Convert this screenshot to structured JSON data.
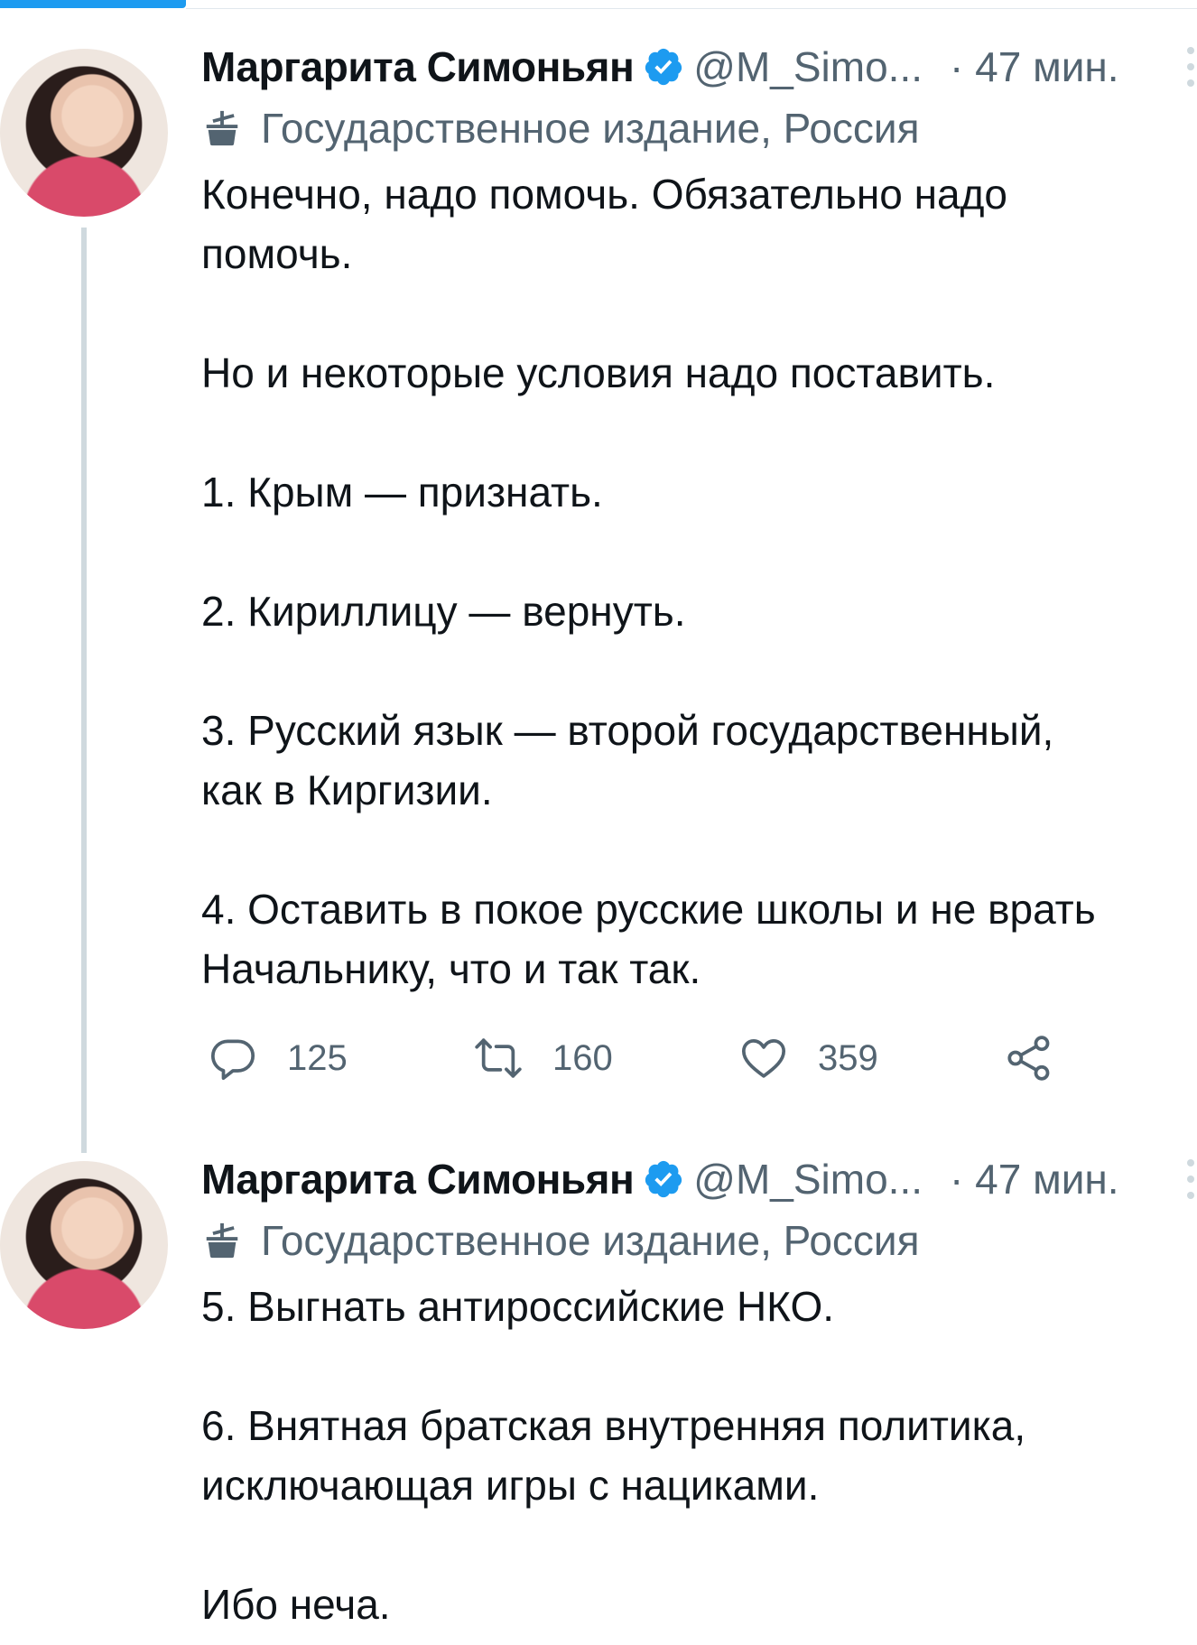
{
  "colors": {
    "accent": "#1d9bf0",
    "text_primary": "#0f1419",
    "text_secondary": "#536471",
    "thread_line": "#cfd9de"
  },
  "tweets": [
    {
      "author_name": "Маргарита Симоньян",
      "handle": "@M_Simo...",
      "time": "· 47 мин.",
      "label": "Государственное издание, Россия",
      "lines": [
        "Конечно, надо помочь. Обязательно надо",
        "помочь.",
        "",
        "Но и некоторые условия надо поставить.",
        "",
        "1. Крым — признать.",
        "",
        "2. Кириллицу — вернуть.",
        "",
        "3. Русский язык — второй государственный,",
        "как в Киргизии.",
        "",
        "4. Оставить в покое русские школы и не врать",
        "Начальнику, что и так так."
      ],
      "replies": "125",
      "retweets": "160",
      "likes": "359"
    },
    {
      "author_name": "Маргарита Симоньян",
      "handle": "@M_Simo...",
      "time": "· 47 мин.",
      "label": "Государственное издание, Россия",
      "lines": [
        "5. Выгнать антироссийские НКО.",
        "",
        "6. Внятная братская внутренняя политика,",
        "исключающая игры с нациками.",
        "",
        "Ибо неча."
      ]
    }
  ]
}
